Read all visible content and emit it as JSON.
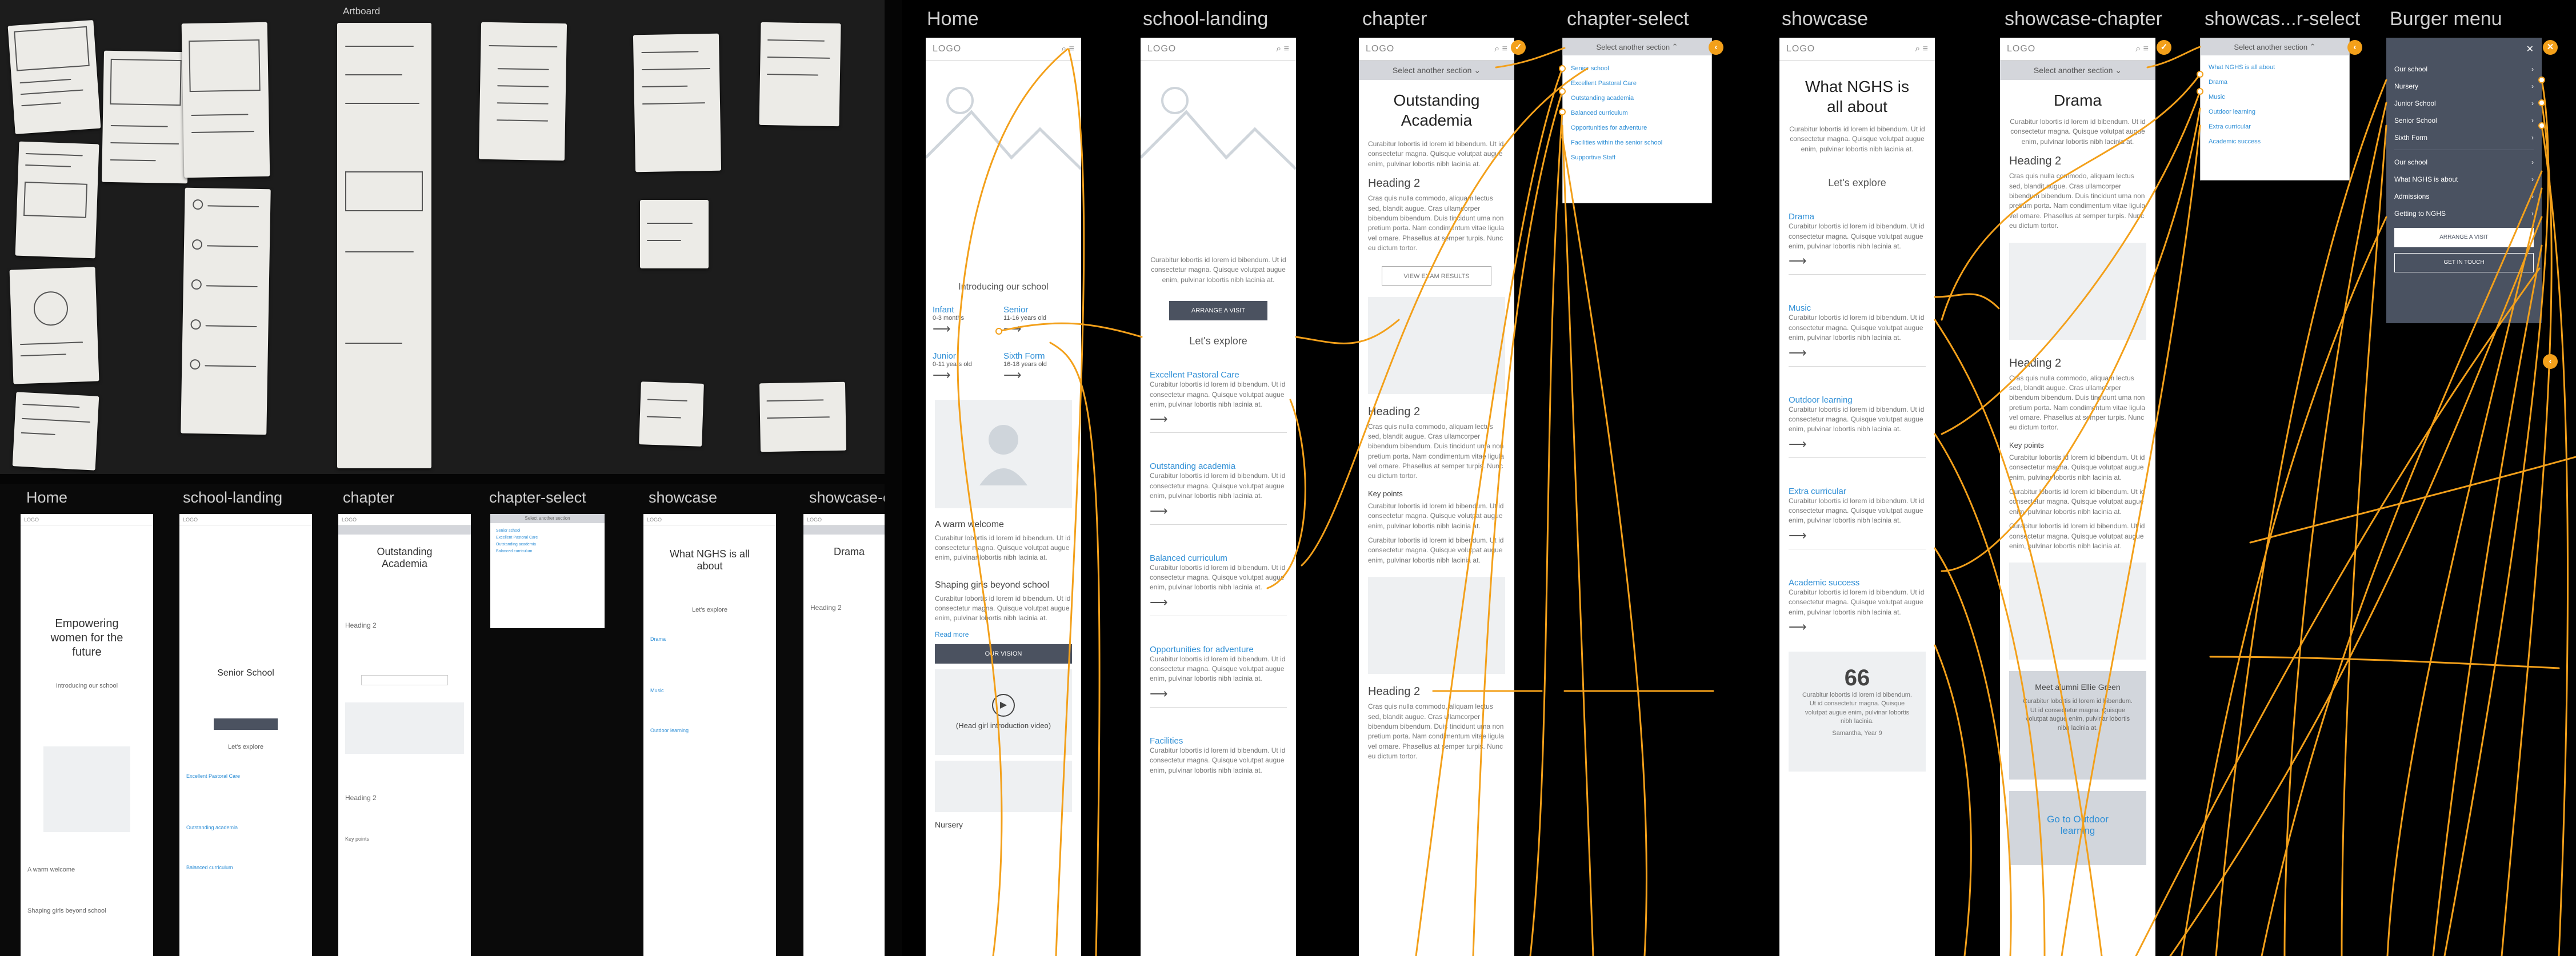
{
  "photo": {
    "artboard_label": "Artboard"
  },
  "screens": [
    {
      "id": "home",
      "label": "Home"
    },
    {
      "id": "school-landing",
      "label": "school-landing"
    },
    {
      "id": "chapter",
      "label": "chapter"
    },
    {
      "id": "chapter-select",
      "label": "chapter-select"
    },
    {
      "id": "showcase",
      "label": "showcase"
    },
    {
      "id": "showcase-chapter",
      "label": "showcase-chapter"
    },
    {
      "id": "showcase-r-select",
      "label": "showcas...r-select"
    },
    {
      "id": "burger",
      "label": "Burger menu"
    }
  ],
  "lower_labels": [
    "Home",
    "school-landing",
    "chapter",
    "chapter-select",
    "showcase",
    "showcase-c"
  ],
  "common": {
    "logo": "LOGO",
    "lorem": "Curabitur lobortis id lorem id bibendum. Ut id consectetur magna. Quisque volutpat augue enim, pulvinar lobortis nibh lacinia at.",
    "lorem2": "Cras quis nulla commodo, aliquam lectus sed, blandit augue. Cras ullamcorper bibendum bibendum. Duis tincidunt uma non pretium porta. Nam condimentum vitae ligula vel ornare. Phasellus at semper turpis. Nunc eu dictum tortor.",
    "heading2": "Heading 2",
    "select_section": "Select another section",
    "arrow": "⟶",
    "lets_explore": "Let's explore",
    "key_points": "Key points"
  },
  "home": {
    "title": "Empowering women for the future",
    "intro": "Introducing our school",
    "tiles": [
      {
        "name": "Infant",
        "age": "0-3 months"
      },
      {
        "name": "Senior",
        "age": "11-16 years old"
      },
      {
        "name": "Junior",
        "age": "0-11 years old"
      },
      {
        "name": "Sixth Form",
        "age": "16-18 years old"
      }
    ],
    "welcome": "A warm welcome",
    "shaping": "Shaping girls beyond school",
    "read_more": "Read more",
    "btn": "OUR VISION",
    "video": "(Head girl introduction video)",
    "nursery": "Nursery"
  },
  "landing": {
    "title": "Senior School",
    "btn": "ARRANGE A VISIT",
    "explore": [
      "Excellent Pastoral Care",
      "Outstanding academia",
      "Balanced curriculum",
      "Opportunities for adventure",
      "Facilities"
    ]
  },
  "chapter": {
    "title": "Outstanding Academia",
    "btn": "VIEW EXAM RESULTS"
  },
  "chapter_select": {
    "items": [
      "Senior school",
      "Excellent Pastoral Care",
      "Outstanding academia",
      "Balanced curriculum",
      "Opportunities for adventure",
      "Facilities within the senior school",
      "Supportive Staff"
    ]
  },
  "showcase": {
    "title": "What NGHS is all about",
    "items": [
      "Drama",
      "Music",
      "Outdoor learning",
      "Extra curricular",
      "Academic success"
    ],
    "quote_mark": "66",
    "quote": "Curabitur lobortis id lorem id bibendum. Ut id consectetur magna. Quisque volutpat augue enim, pulvinar lobortis nibh lacinia.",
    "quote_by": "Samantha, Year 9"
  },
  "showcase_chapter": {
    "title": "Drama",
    "alumni_title": "Meet alumni Ellie Green",
    "next": "Go to Outdoor learning"
  },
  "showcase_select": {
    "items": [
      "What NGHS is all about",
      "Drama",
      "Music",
      "Outdoor learning",
      "Extra curricular",
      "Academic success"
    ]
  },
  "burger": {
    "items": [
      "Our school",
      "Nursery",
      "Junior School",
      "Senior School",
      "Sixth Form"
    ],
    "items2": [
      "Our school",
      "What NGHS is about",
      "Admissions",
      "Getting to NGHS"
    ],
    "btn1": "ARRANGE A VISIT",
    "btn2": "GET IN TOUCH"
  },
  "colors": {
    "accent": "#f3a01a",
    "link": "#2f8fd6",
    "dark": "#4a5261"
  }
}
